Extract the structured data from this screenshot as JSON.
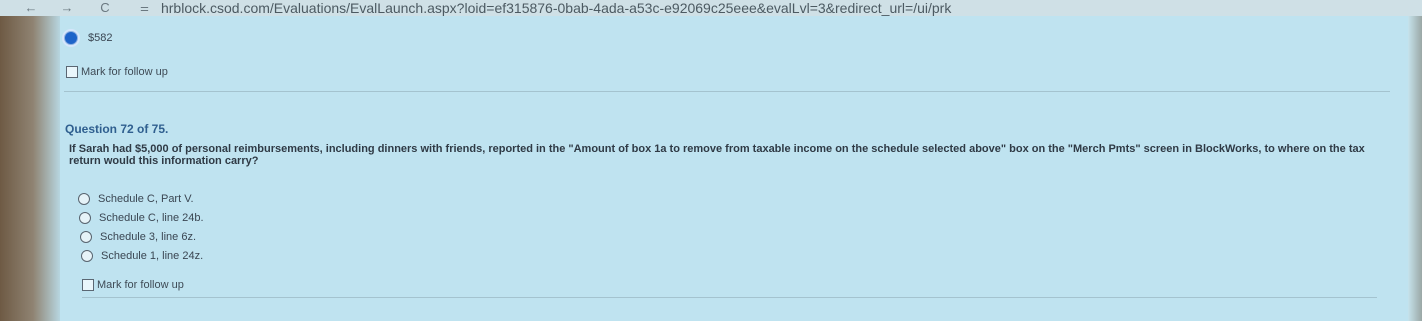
{
  "browser": {
    "back_icon": "←",
    "forward_icon": "→",
    "reload_icon": "C",
    "site_icon": "⚌",
    "url": "hrblock.csod.com/Evaluations/EvalLaunch.aspx?loid=ef315876-0bab-4ada-a53c-e92069c25eee&evalLvl=3&redirect_url=/ui/prk"
  },
  "previous_question": {
    "selected_answer": "$582",
    "mark_label": "Mark for follow up"
  },
  "question": {
    "number": "Question 72 of 75.",
    "text": "If Sarah had $5,000 of personal reimbursements, including dinners with friends, reported in the \"Amount of box 1a to remove from taxable income on the schedule selected above\" box on the \"Merch Pmts\" screen in BlockWorks, to where on the tax return would this information carry?",
    "options": [
      "Schedule C, Part V.",
      "Schedule C, line 24b.",
      "Schedule 3, line 6z.",
      "Schedule 1, line 24z."
    ],
    "mark_label": "Mark for follow up"
  }
}
